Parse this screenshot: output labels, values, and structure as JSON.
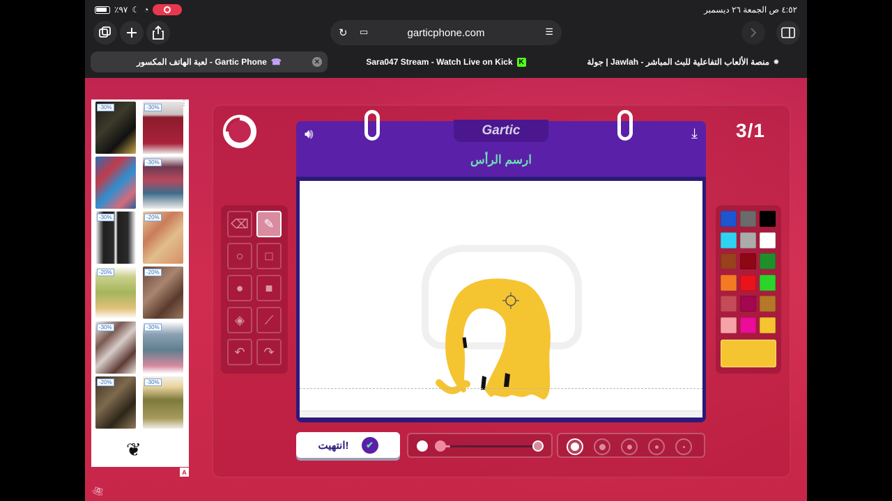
{
  "status_bar": {
    "time_date": "٤:٥٢ ص  الجمعة ٢٦ ديسمبر",
    "battery": "٪٩٧"
  },
  "browser": {
    "url": "garticphone.com",
    "tabs": [
      {
        "label": "لعبة الهاتف المكسور - Gartic Phone",
        "active": true
      },
      {
        "label": "Sara047 Stream - Watch Live on Kick",
        "active": false
      },
      {
        "label": "جولة | Jawlah - منصة الألعاب التفاعلية للبث المباشر",
        "active": false
      }
    ],
    "icons": [
      "tabs-overview-icon",
      "new-tab-icon",
      "share-icon",
      "reload-icon",
      "reader-icon",
      "tab-grid-icon",
      "forward-icon",
      "sidebar-icon"
    ]
  },
  "ad": {
    "badges": [
      "-30%",
      "-30%",
      "-30%",
      "-30%",
      "-20%",
      "-20%",
      "-20%",
      "-30%",
      "-30%",
      "-20%",
      "-30%"
    ],
    "choice_mark": "A"
  },
  "game": {
    "brand": "Gartic",
    "round": "3/1",
    "prompt": "ارسم الرأس",
    "done_label": "انتهيت!",
    "timer_fraction_remaining": 0.75,
    "selected_tool": "pen",
    "current_color": "#f5c431",
    "opacity_fraction": 1.0,
    "selected_size_index": 0
  },
  "palette": {
    "colors": [
      "#1e55d1",
      "#6b6b6b",
      "#000000",
      "#2fd3f2",
      "#ababab",
      "#ffffff",
      "#99401c",
      "#8d0715",
      "#1f8f2c",
      "#f47b24",
      "#e8131b",
      "#2bd42b",
      "#c64b58",
      "#a2074f",
      "#b47826",
      "#f6a3a8",
      "#eb0c98",
      "#f5c431"
    ]
  }
}
